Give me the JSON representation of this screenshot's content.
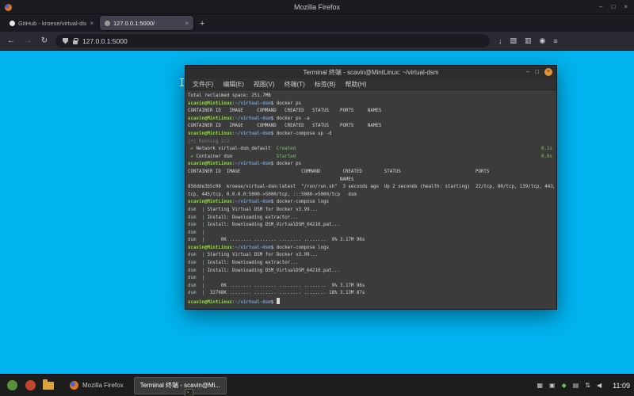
{
  "colors": {
    "page_bg": "#00b2ee",
    "prompt_green": "#8ae234",
    "path_blue": "#729fcf",
    "success_green": "#78c862",
    "terminal_bg": "#3b3b3b",
    "panel_bg": "#1d1d1d",
    "terminal_close_button": "#e0953c",
    "active_tab_bg": "#42414d"
  },
  "firefox": {
    "window_title": "Mozilla Firefox",
    "window_controls": [
      {
        "name": "minimize-button",
        "glyph": "–"
      },
      {
        "name": "maximize-button",
        "glyph": "□"
      },
      {
        "name": "close-button",
        "glyph": "×"
      }
    ],
    "tabs": [
      {
        "label": "GitHub - kroese/virtual-dsm",
        "active": false,
        "favicon_color": "#e8e8e8",
        "close_glyph": "×"
      },
      {
        "label": "127.0.0.1:5000/",
        "active": true,
        "favicon_color": "#9a9a9a",
        "close_glyph": "×"
      }
    ],
    "new_tab_glyph": "+",
    "nav": {
      "back_glyph": "←",
      "forward_glyph": "→",
      "reload_glyph": "↻",
      "url": "127.0.0.1:5000",
      "right_icons": [
        {
          "name": "downloads-icon",
          "glyph": "↓"
        },
        {
          "name": "extensions-icon",
          "glyph": "▧"
        },
        {
          "name": "library-icon",
          "glyph": "▥"
        },
        {
          "name": "account-icon",
          "glyph": "◉"
        },
        {
          "name": "menu-icon",
          "glyph": "≡"
        }
      ]
    }
  },
  "terminal": {
    "title": "Terminal 终端 - scavin@MintLinux: ~/virtual-dsm",
    "window_controls": [
      {
        "name": "terminal-minimize-button",
        "glyph": "–"
      },
      {
        "name": "terminal-maximize-button",
        "glyph": "□"
      }
    ],
    "close_glyph": "×",
    "menus": [
      "文件(F)",
      "编辑(E)",
      "视图(V)",
      "终端(T)",
      "标签(B)",
      "帮助(H)"
    ],
    "prompt": {
      "user": "scavin@MintLinux",
      "colon": ":",
      "path": "~/virtual-dsm",
      "suffix": "$ "
    },
    "lines": [
      {
        "s": [
          {
            "t": "Total reclaimed space: 251.7MB",
            "c": "w"
          }
        ]
      },
      {
        "prompt": true,
        "cmd": "docker ps"
      },
      {
        "s": [
          {
            "t": "CONTAINER ID   IMAGE     COMMAND   CREATED   STATUS    PORTS     NAMES",
            "c": "w"
          }
        ]
      },
      {
        "prompt": true,
        "cmd": "docker ps -a"
      },
      {
        "s": [
          {
            "t": "CONTAINER ID   IMAGE     COMMAND   CREATED   STATUS    PORTS     NAMES",
            "c": "w"
          }
        ]
      },
      {
        "prompt": true,
        "cmd": "docker-compose up -d"
      },
      {
        "s": [
          {
            "t": "[+] Running 2/2",
            "c": "dim"
          }
        ]
      },
      {
        "s": [
          {
            "t": " ✔ ",
            "c": "g"
          },
          {
            "t": "Network virtual-dsm_default  ",
            "c": "w"
          },
          {
            "t": "Created",
            "c": "g"
          }
        ],
        "r": [
          {
            "t": "0.1s",
            "c": "g"
          }
        ]
      },
      {
        "s": [
          {
            "t": " ✔ ",
            "c": "g"
          },
          {
            "t": "Container dsm                ",
            "c": "w"
          },
          {
            "t": "Started",
            "c": "g"
          }
        ],
        "r": [
          {
            "t": "0.0s",
            "c": "g"
          }
        ]
      },
      {
        "prompt": true,
        "cmd": "docker ps"
      },
      {
        "s": [
          {
            "t": "CONTAINER ID  IMAGE                      COMMAND        CREATED        STATUS                           PORTS",
            "c": "w"
          }
        ]
      },
      {
        "s": [
          {
            "t": "                                                       NAMES",
            "c": "w"
          }
        ]
      },
      {
        "s": [
          {
            "t": "856dde3b5c08  kroese/virtual-dsm:latest  \"/run/run.sh\"  3 seconds ago  Up 2 seconds (health: starting)  22/tcp, 80/tcp, 139/tcp, 443/",
            "c": "w"
          }
        ]
      },
      {
        "s": [
          {
            "t": "tcp, 445/tcp, 0.0.0.0:5000->5000/tcp, :::5000->5000/tcp   dsm",
            "c": "w"
          }
        ]
      },
      {
        "prompt": true,
        "cmd": "docker-compose logs"
      },
      {
        "s": [
          {
            "t": "dsm  | ",
            "c": "svc"
          },
          {
            "t": "Starting Virtual DSM for Docker v3.99...",
            "c": "w"
          }
        ]
      },
      {
        "s": [
          {
            "t": "dsm  | ",
            "c": "svc"
          },
          {
            "t": "Install: Downloading extractor...",
            "c": "w"
          }
        ]
      },
      {
        "s": [
          {
            "t": "dsm  | ",
            "c": "svc"
          },
          {
            "t": "Install: Downloading DSM_VirtualDSM_64216.pat...",
            "c": "w"
          }
        ]
      },
      {
        "s": [
          {
            "t": "dsm  |",
            "c": "svc"
          }
        ]
      },
      {
        "s": [
          {
            "t": "dsm  | ",
            "c": "svc"
          },
          {
            "t": "     0K ........ ........ ........ ........  9% 3.17M 96s",
            "c": "w"
          }
        ]
      },
      {
        "prompt": true,
        "cmd": "docker-compose logs"
      },
      {
        "s": [
          {
            "t": "dsm  | ",
            "c": "svc"
          },
          {
            "t": "Starting Virtual DSM for Docker v3.99...",
            "c": "w"
          }
        ]
      },
      {
        "s": [
          {
            "t": "dsm  | ",
            "c": "svc"
          },
          {
            "t": "Install: Downloading extractor...",
            "c": "w"
          }
        ]
      },
      {
        "s": [
          {
            "t": "dsm  | ",
            "c": "svc"
          },
          {
            "t": "Install: Downloading DSM_VirtualDSM_64216.pat...",
            "c": "w"
          }
        ]
      },
      {
        "s": [
          {
            "t": "dsm  |",
            "c": "svc"
          }
        ]
      },
      {
        "s": [
          {
            "t": "dsm  | ",
            "c": "svc"
          },
          {
            "t": "     0K ........ ........ ........ ........  9% 3.17M 96s",
            "c": "w"
          }
        ]
      },
      {
        "s": [
          {
            "t": "dsm  | ",
            "c": "svc"
          },
          {
            "t": " 32768K ........ ........ ........ ........ 18% 3.13M 87s",
            "c": "w"
          }
        ]
      },
      {
        "prompt": true,
        "cursor": true
      }
    ]
  },
  "taskbar": {
    "launchers": [
      {
        "name": "menu-button",
        "type": "circle",
        "color": "#5a8f3c"
      },
      {
        "name": "browser-launcher",
        "type": "circle",
        "color": "#c2452e"
      },
      {
        "name": "files-launcher",
        "type": "folder",
        "color": "#d8a43b"
      }
    ],
    "windows": [
      {
        "label": "Mozilla Firefox",
        "icon": "firefox",
        "active": false
      },
      {
        "label": "Terminal 终端 - scavin@Mi...",
        "icon": "terminal",
        "active": true
      }
    ],
    "tray": [
      {
        "name": "workspace-switcher-icon",
        "glyph": "▦",
        "color": "#c8c8c8"
      },
      {
        "name": "notifications-icon",
        "glyph": "▣",
        "color": "#c8c8c8"
      },
      {
        "name": "shield-icon",
        "glyph": "◆",
        "color": "#7cb95a"
      },
      {
        "name": "clipboard-icon",
        "glyph": "▤",
        "color": "#c8c8c8"
      },
      {
        "name": "network-icon",
        "glyph": "⇅",
        "color": "#c8c8c8"
      },
      {
        "name": "volume-icon",
        "glyph": "◀",
        "color": "#c8c8c8"
      }
    ],
    "clock": "11:09"
  }
}
